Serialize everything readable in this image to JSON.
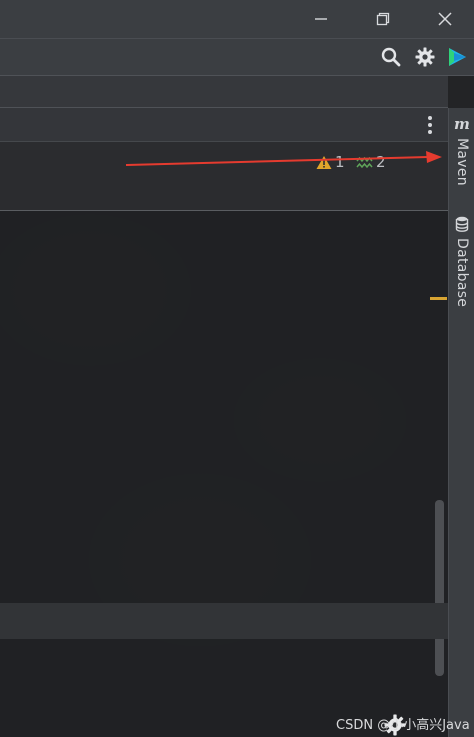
{
  "window": {
    "minimize_icon": "minimize-icon",
    "restore_icon": "restore-icon",
    "close_icon": "close-icon"
  },
  "toolbar": {
    "search_icon": "search-icon",
    "settings_icon": "gear-icon",
    "plugin_icon": "plugin-logo-icon"
  },
  "tabs": {
    "more_icon": "more-vertical-icon"
  },
  "inspections": {
    "warnings_count": "1",
    "weak_warnings_count": "2",
    "warning_color": "#e0a52b",
    "weak_warning_color": "#5fa55a"
  },
  "right_panel": {
    "maven_label": "Maven",
    "maven_icon": "maven-m-icon",
    "database_label": "Database",
    "database_icon": "database-icon"
  },
  "annotation": {
    "arrow_color": "#e53b2f"
  },
  "watermark": {
    "text": "CSDN @小小高兴Java"
  },
  "colors": {
    "panel_bg": "#3b3e42",
    "editor_bg": "#232426",
    "marker": "#d8a432"
  }
}
